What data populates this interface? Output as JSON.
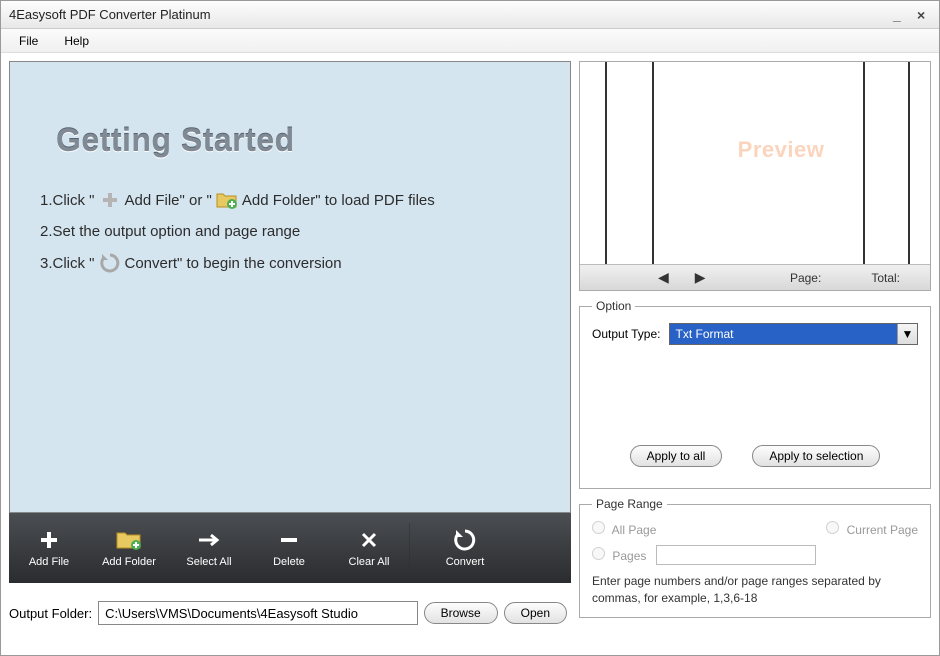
{
  "window": {
    "title": "4Easysoft PDF Converter Platinum"
  },
  "menu": {
    "file": "File",
    "help": "Help"
  },
  "gettingStarted": {
    "title": "Getting Started",
    "line1a": "1.Click \"",
    "line1b": "Add File\" or \"",
    "line1c": "Add Folder\" to load PDF files",
    "line2": "2.Set the output option and page range",
    "line3a": "3.Click \"",
    "line3b": "Convert\" to begin the conversion"
  },
  "toolbar": {
    "addFile": "Add File",
    "addFolder": "Add Folder",
    "selectAll": "Select All",
    "delete": "Delete",
    "clearAll": "Clear All",
    "convert": "Convert"
  },
  "outputFolder": {
    "label": "Output Folder:",
    "value": "C:\\Users\\VMS\\Documents\\4Easysoft Studio",
    "browse": "Browse",
    "open": "Open"
  },
  "preview": {
    "watermark": "Preview",
    "pageLabel": "Page:",
    "totalLabel": "Total:"
  },
  "option": {
    "legend": "Option",
    "outputTypeLabel": "Output Type:",
    "outputTypeValue": "Txt Format",
    "applyAll": "Apply to all",
    "applySelection": "Apply to selection"
  },
  "pageRange": {
    "legend": "Page Range",
    "allPage": "All Page",
    "currentPage": "Current Page",
    "pages": "Pages",
    "hint": "Enter page numbers and/or page ranges separated by commas, for example, 1,3,6-18"
  }
}
